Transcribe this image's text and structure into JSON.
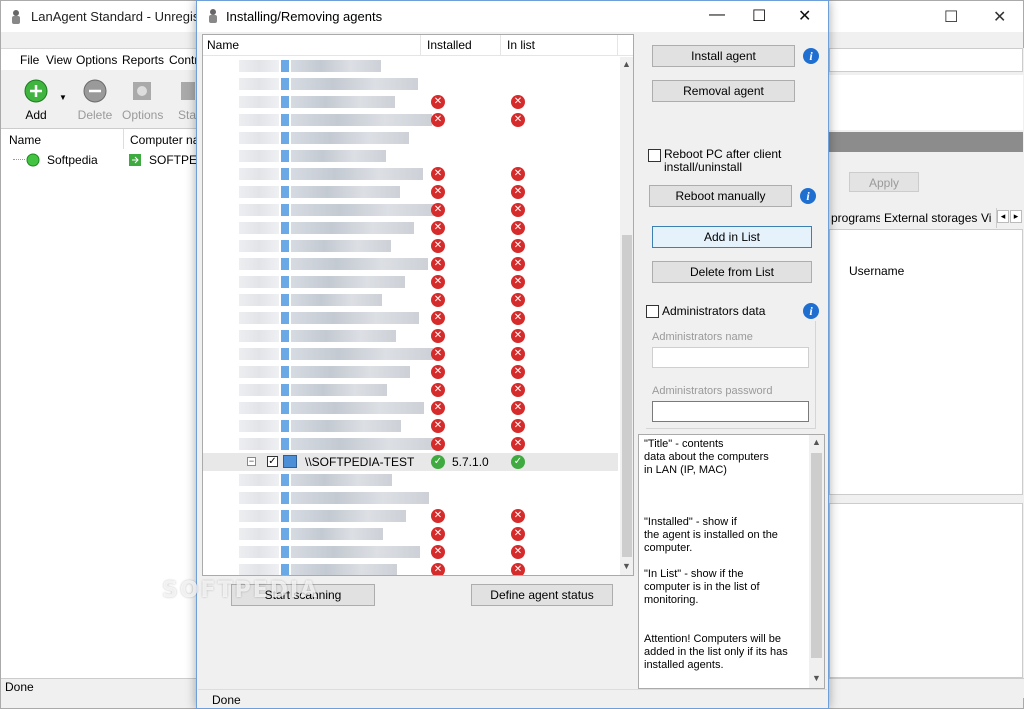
{
  "main_window": {
    "title": "LanAgent Standard - Unregister",
    "menu": [
      "File",
      "View",
      "Options",
      "Reports",
      "Contr"
    ],
    "toolbar": [
      {
        "label": "Add",
        "icon": "add-icon",
        "enabled": true
      },
      {
        "label": "Delete",
        "icon": "delete-icon",
        "enabled": false
      },
      {
        "label": "Options",
        "icon": "options-icon",
        "enabled": false
      },
      {
        "label": "Sta",
        "icon": "start-icon",
        "enabled": false
      }
    ],
    "columns": [
      "Name",
      "Computer nam"
    ],
    "rows": [
      {
        "name": "Softpedia",
        "computer": "SOFTPEDI"
      }
    ],
    "apply_label": "Apply",
    "tabs": [
      "programs",
      "External storages",
      "Vi"
    ],
    "list_header": "Username",
    "status": "Done"
  },
  "dialog": {
    "title": "Installing/Removing agents",
    "columns": {
      "name": "Name",
      "installed": "Installed",
      "in_list": "In list"
    },
    "buttons": {
      "install": "Install agent",
      "removal": "Removal agent",
      "reboot_manually": "Reboot manually",
      "add_in_list": "Add in List",
      "delete_from_list": "Delete from List",
      "start_scanning": "Start scanning",
      "define_status": "Define agent status"
    },
    "reboot_checkbox": "Reboot PC after client install/uninstall",
    "admin_checkbox": "Administrators data",
    "admin_name_label": "Administrators name",
    "admin_password_label": "Administrators password",
    "selected_computer": {
      "name": "\\\\SOFTPEDIA-TEST",
      "version": "5.7.1.0",
      "checked": true
    },
    "help_text": [
      "\"Title\" - contents\ndata about the computers\nin LAN (IP, MAC)",
      "\"Installed\" - show if\nthe agent is installed on the\ncomputer.",
      "\"In List\" - show if the\ncomputer is in the list of\nmonitoring.",
      "Attention! Computers will be\nadded in the list only if its has\ninstalled agents."
    ],
    "status": "Done"
  },
  "colors": {
    "accent": "#1f6fd1",
    "error": "#d62b2b",
    "ok": "#3faa3f",
    "focus": "#3c7fb1"
  },
  "watermark": "SOFTPEDIA"
}
